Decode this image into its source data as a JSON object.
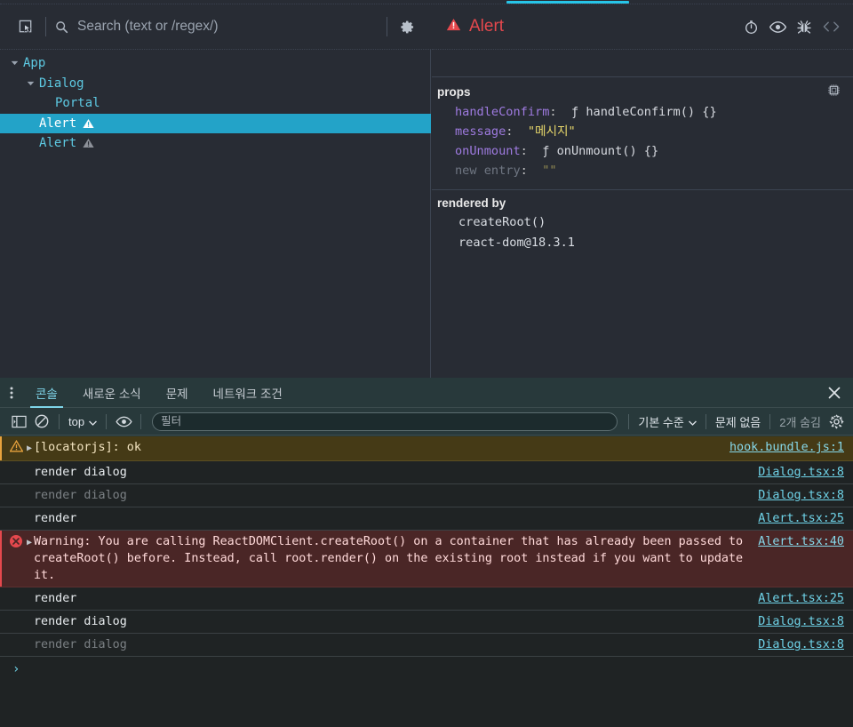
{
  "devtools": {
    "components_panel": {
      "toolbar": {
        "select_element_icon": "select-element-icon",
        "search_icon": "search-icon",
        "search_value": "",
        "search_placeholder": "Search (text or /regex/)",
        "settings_icon": "gear-icon"
      },
      "tree": [
        {
          "label": "App",
          "depth": 0,
          "arrow": "expanded",
          "selected": false,
          "badge": "none"
        },
        {
          "label": "Dialog",
          "depth": 1,
          "arrow": "expanded",
          "selected": false,
          "badge": "none"
        },
        {
          "label": "Portal",
          "depth": 2,
          "arrow": "none",
          "selected": false,
          "badge": "none"
        },
        {
          "label": "Alert",
          "depth": 1,
          "arrow": "none",
          "selected": true,
          "badge": "warning-white"
        },
        {
          "label": "Alert",
          "depth": 1,
          "arrow": "none",
          "selected": false,
          "badge": "warning-gray"
        }
      ],
      "inspector": {
        "element_name": "Alert",
        "element_icon": "warning-triangle-icon",
        "actions": [
          {
            "name": "suspense-timer-icon"
          },
          {
            "name": "eye-icon"
          },
          {
            "name": "bug-icon"
          },
          {
            "name": "source-code-icon"
          }
        ],
        "props": {
          "title": "props",
          "copy_icon": "component-chip-icon",
          "rows": [
            {
              "key": "handleConfirm",
              "value": "ƒ handleConfirm() {}",
              "type": "function",
              "dim": false
            },
            {
              "key": "message",
              "value": "\"메시지\"",
              "type": "string",
              "dim": false
            },
            {
              "key": "onUnmount",
              "value": "ƒ onUnmount() {}",
              "type": "function",
              "dim": false
            },
            {
              "key": "new entry",
              "value": "\"\"",
              "type": "string",
              "dim": true
            }
          ]
        },
        "rendered_by": {
          "title": "rendered by",
          "rows": [
            "createRoot()",
            "react-dom@18.3.1"
          ]
        }
      }
    },
    "drawer": {
      "more_icon": "more-vertical-icon",
      "close_icon": "close-icon",
      "tabs": [
        {
          "label": "콘솔",
          "active": true
        },
        {
          "label": "새로운 소식",
          "active": false
        },
        {
          "label": "문제",
          "active": false
        },
        {
          "label": "네트워크 조건",
          "active": false
        }
      ],
      "console_toolbar": {
        "sidebar_icon": "console-sidebar-icon",
        "clear_icon": "clear-console-icon",
        "context_label": "top",
        "context_caret": "chevron-down-icon",
        "eye_icon": "live-expression-icon",
        "filter_value": "",
        "filter_placeholder": "필터",
        "levels_label": "기본 수준",
        "levels_caret": "chevron-down-icon",
        "issues_label": "문제 없음",
        "hidden_label": "2개 숨김",
        "settings_icon": "console-settings-icon"
      },
      "logs": [
        {
          "level": "warning",
          "expandable": true,
          "icon": "warning-triangle-icon",
          "text": "[locatorjs]: ok",
          "source": "hook.bundle.js:1",
          "dim": false
        },
        {
          "level": "log",
          "expandable": false,
          "icon": "none",
          "text": "render dialog",
          "source": "Dialog.tsx:8",
          "dim": false
        },
        {
          "level": "log",
          "expandable": false,
          "icon": "none",
          "text": "render dialog",
          "source": "Dialog.tsx:8",
          "dim": true
        },
        {
          "level": "log",
          "expandable": false,
          "icon": "none",
          "text": "render",
          "source": "Alert.tsx:25",
          "dim": false
        },
        {
          "level": "error",
          "expandable": true,
          "icon": "error-circle-icon",
          "text": "Warning: You are calling ReactDOMClient.createRoot() on a container that has already been passed to createRoot() before. Instead, call root.render() on the existing root instead if you want to update it.",
          "source": "Alert.tsx:40",
          "dim": false
        },
        {
          "level": "log",
          "expandable": false,
          "icon": "none",
          "text": "render",
          "source": "Alert.tsx:25",
          "dim": false
        },
        {
          "level": "log",
          "expandable": false,
          "icon": "none",
          "text": "render dialog",
          "source": "Dialog.tsx:8",
          "dim": false
        },
        {
          "level": "log",
          "expandable": false,
          "icon": "none",
          "text": "render dialog",
          "source": "Dialog.tsx:8",
          "dim": true
        }
      ],
      "prompt_symbol": "›"
    }
  },
  "colors": {
    "accent_cyan": "#27c5e8",
    "tree_selected": "#23a3c8",
    "element_red": "#e5484d",
    "string_yellow": "#e8d86b",
    "prop_key_purple": "#9f7be1",
    "link_cyan": "#6fd3e8",
    "warning_bg": "#453a16",
    "error_bg": "#4a2626"
  }
}
